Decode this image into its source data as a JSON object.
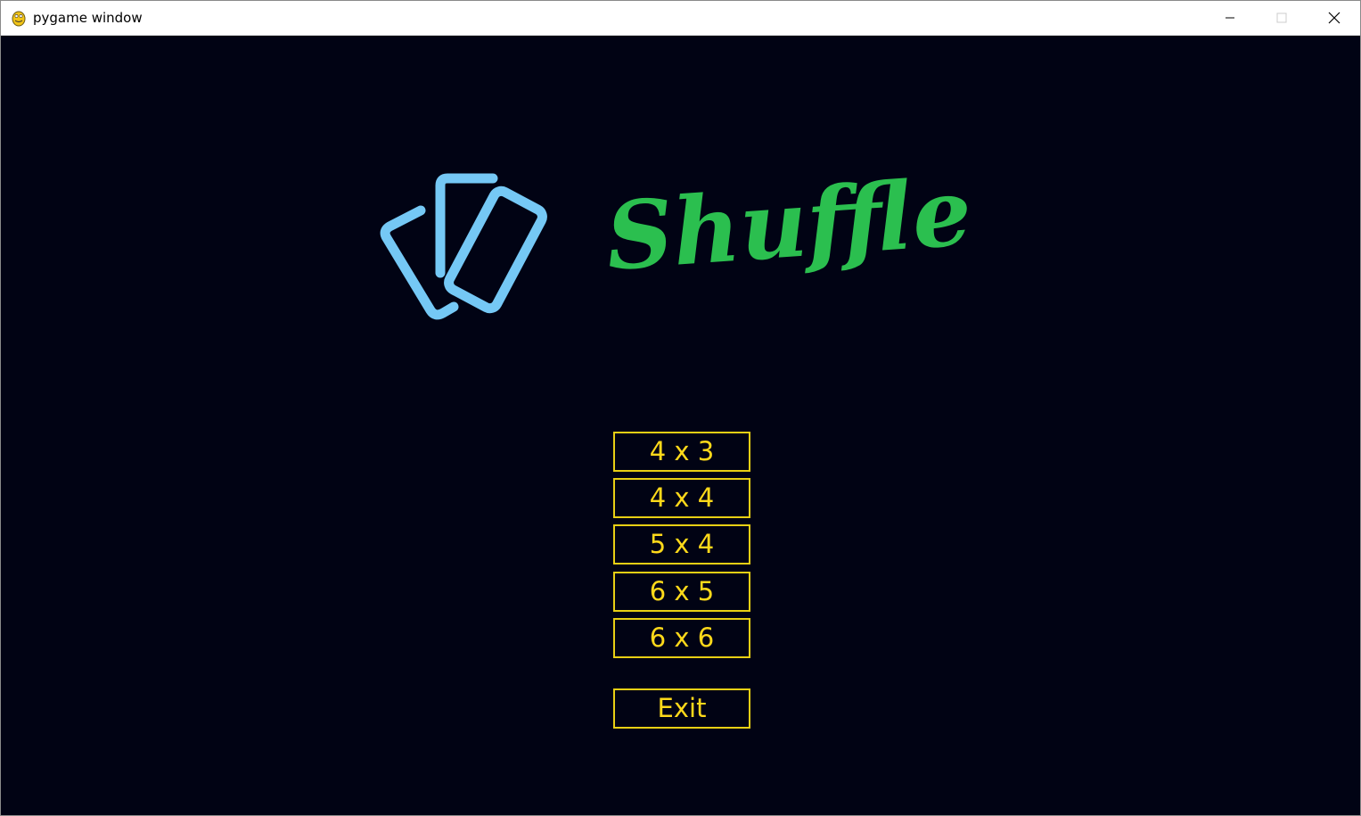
{
  "window": {
    "title": "pygame window",
    "icon": "pygame-snake-icon",
    "controls": [
      "minimize-icon",
      "maximize-icon",
      "close-icon"
    ]
  },
  "logo": {
    "title": "Shuffle",
    "icon": "cards-icon"
  },
  "menu": {
    "options": [
      "4 x 3",
      "4 x 4",
      "5 x 4",
      "6 x 5",
      "6 x 6"
    ],
    "exit_label": "Exit"
  },
  "colors": {
    "background": "#010314",
    "cards_icon": "#75c8f5",
    "logo_text": "#2bbf4f",
    "button_border": "#e8cf14",
    "button_text": "#ffd91a"
  }
}
